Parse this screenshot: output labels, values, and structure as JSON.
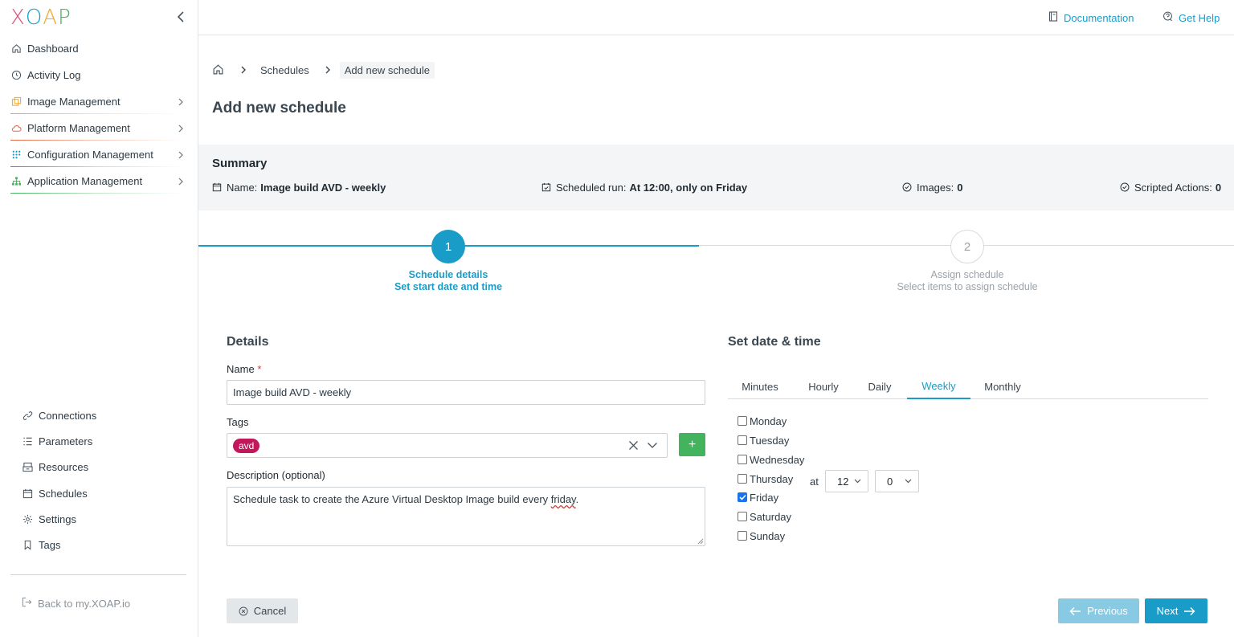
{
  "app": {
    "logo_letters": [
      "X",
      "O",
      "A",
      "P"
    ],
    "logo_colors": [
      "#e94b7a",
      "#1a9cc9",
      "#f5a623",
      "#43b35e"
    ]
  },
  "sidebar": {
    "top_items": [
      {
        "label": "Dashboard",
        "icon": "home-icon",
        "has_children": false
      },
      {
        "label": "Activity Log",
        "icon": "clock-icon",
        "has_children": false
      },
      {
        "label": "Image Management",
        "icon": "images-icon",
        "has_children": true,
        "accent": "#f5a623"
      },
      {
        "label": "Platform Management",
        "icon": "cloud-icon",
        "has_children": true,
        "accent": "#e8643c"
      },
      {
        "label": "Configuration Management",
        "icon": "grid-icon",
        "has_children": true,
        "accent": "#1a9cc9"
      },
      {
        "label": "Application Management",
        "icon": "hierarchy-icon",
        "has_children": true,
        "accent": "#43b35e"
      }
    ],
    "bottom_items": [
      {
        "label": "Connections",
        "icon": "link-icon"
      },
      {
        "label": "Parameters",
        "icon": "list-icon"
      },
      {
        "label": "Resources",
        "icon": "stack-icon"
      },
      {
        "label": "Schedules",
        "icon": "calendar-icon"
      },
      {
        "label": "Settings",
        "icon": "gear-icon"
      },
      {
        "label": "Tags",
        "icon": "bookmark-icon"
      }
    ],
    "back_link": "Back to my.XOAP.io"
  },
  "topbar": {
    "documentation": "Documentation",
    "help": "Get Help"
  },
  "breadcrumb": {
    "items": [
      "Schedules",
      "Add new schedule"
    ]
  },
  "page": {
    "title": "Add new schedule"
  },
  "summary": {
    "title": "Summary",
    "name_label": "Name:",
    "name_value": "Image build AVD - weekly",
    "run_label": "Scheduled run:",
    "run_value": "At 12:00, only on Friday",
    "images_label": "Images:",
    "images_value": "0",
    "actions_label": "Scripted Actions:",
    "actions_value": "0"
  },
  "stepper": {
    "steps": [
      {
        "number": "1",
        "title": "Schedule details",
        "subtitle": "Set start date and time",
        "active": true
      },
      {
        "number": "2",
        "title": "Assign schedule",
        "subtitle": "Select items to assign schedule",
        "active": false
      }
    ]
  },
  "details": {
    "title": "Details",
    "name_label": "Name",
    "required_mark": "*",
    "name_value": "Image build AVD - weekly",
    "tags_label": "Tags",
    "tags": [
      "avd"
    ],
    "add_tag": "+",
    "description_label": "Description (optional)",
    "description_prefix": "Schedule task to create the Azure Virtual Desktop Image build every ",
    "description_misspelled": "friday",
    "description_suffix": "."
  },
  "datetime": {
    "title": "Set date & time",
    "tabs": [
      "Minutes",
      "Hourly",
      "Daily",
      "Weekly",
      "Monthly"
    ],
    "active_tab": "Weekly",
    "days": [
      {
        "label": "Monday",
        "checked": false
      },
      {
        "label": "Tuesday",
        "checked": false
      },
      {
        "label": "Wednesday",
        "checked": false
      },
      {
        "label": "Thursday",
        "checked": false
      },
      {
        "label": "Friday",
        "checked": true
      },
      {
        "label": "Saturday",
        "checked": false
      },
      {
        "label": "Sunday",
        "checked": false
      }
    ],
    "at_label": "at",
    "hour": "12",
    "minute": "0"
  },
  "buttons": {
    "cancel": "Cancel",
    "previous": "Previous",
    "next": "Next"
  },
  "colors": {
    "accent": "#1a9cc9",
    "success": "#43b35e",
    "tag": "#c2185b"
  }
}
